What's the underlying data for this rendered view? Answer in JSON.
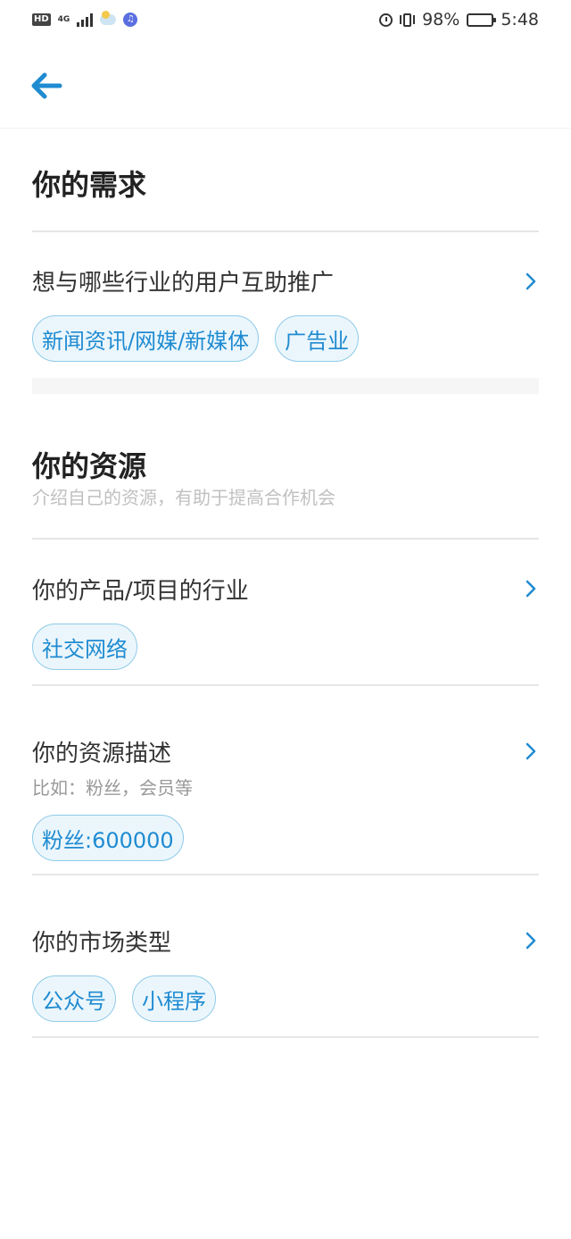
{
  "status_bar": {
    "hd": "HD",
    "network": "4G",
    "battery_percent": "98%",
    "time": "5:48",
    "icons": [
      "signal-icon",
      "weather-icon",
      "music-app-icon",
      "alarm-icon",
      "vibrate-icon",
      "battery-icon"
    ]
  },
  "nav": {
    "back_icon": "arrow-left-icon",
    "accent_color": "#1f8bd1"
  },
  "demand": {
    "title": "你的需求",
    "row_industry": {
      "label": "想与哪些行业的用户互助推广",
      "tags": [
        "新闻资讯/网媒/新媒体",
        "广告业"
      ]
    }
  },
  "resources": {
    "title": "你的资源",
    "subtitle": "介绍自己的资源，有助于提高合作机会",
    "row_product_industry": {
      "label": "你的产品/项目的行业",
      "tags": [
        "社交网络"
      ]
    },
    "row_description": {
      "label": "你的资源描述",
      "hint": "比如：粉丝，会员等",
      "tags": [
        "粉丝:600000"
      ]
    },
    "row_market": {
      "label": "你的市场类型",
      "tags": [
        "公众号",
        "小程序"
      ]
    }
  }
}
